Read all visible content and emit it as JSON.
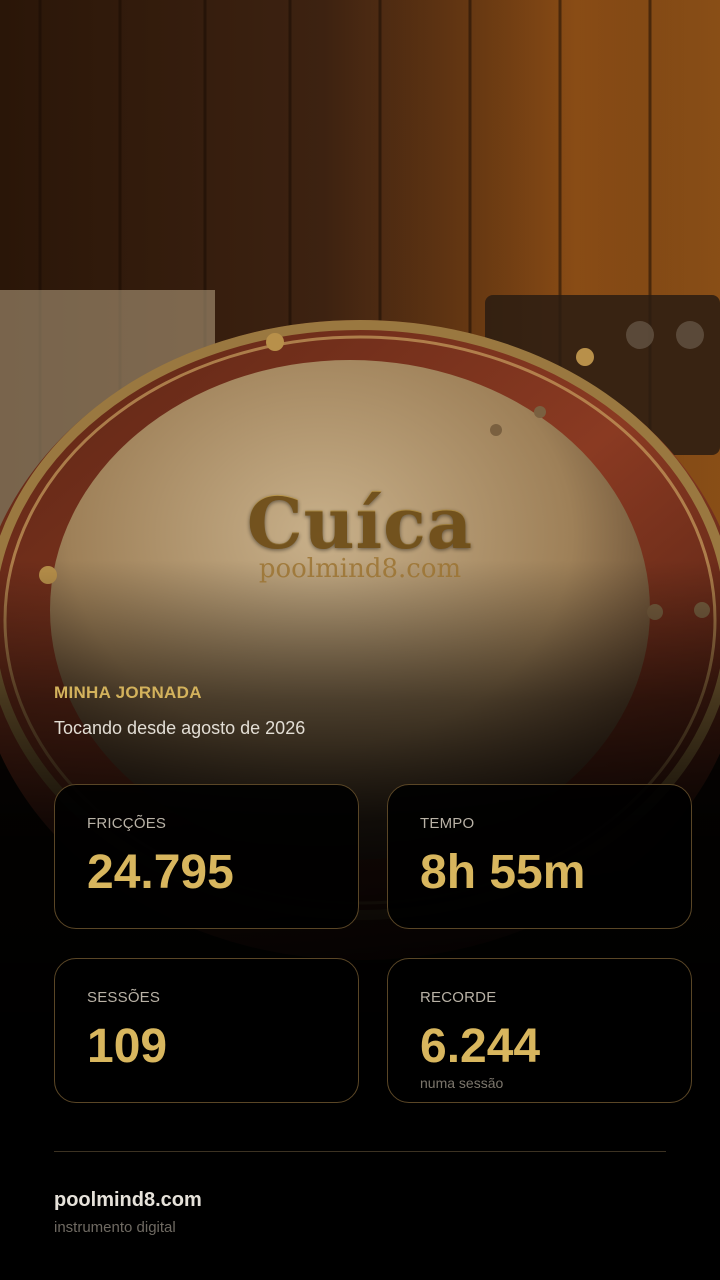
{
  "logo": {
    "title": "Cuíca",
    "subtitle": "poolmind8.com"
  },
  "journey": {
    "label": "MINHA JORNADA",
    "since": "Tocando desde agosto de 2026"
  },
  "stats": {
    "friccoes": {
      "label": "FRICÇÕES",
      "value": "24.795"
    },
    "tempo": {
      "label": "TEMPO",
      "value": "8h 55m"
    },
    "sessoes": {
      "label": "SESSÕES",
      "value": "109"
    },
    "recorde": {
      "label": "RECORDE",
      "value": "6.244",
      "note": "numa sessão"
    }
  },
  "footer": {
    "brand": "poolmind8.com",
    "tagline": "instrumento digital"
  },
  "colors": {
    "accent": "#d8b65e",
    "card_border": "#5a4626",
    "background": "#000000"
  }
}
